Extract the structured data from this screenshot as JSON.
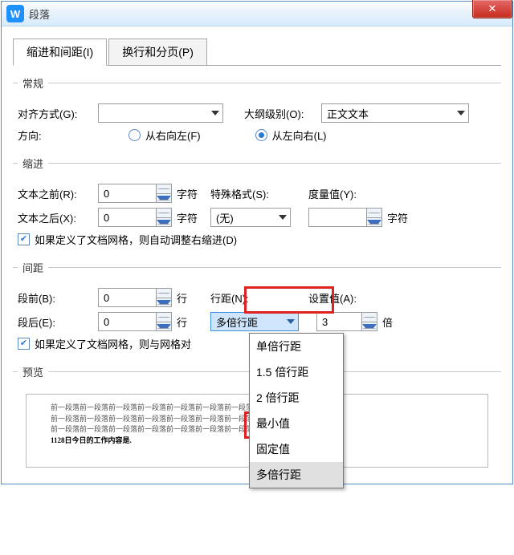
{
  "window": {
    "title": "段落",
    "icon_letter": "W",
    "close_glyph": "✕"
  },
  "tabs": {
    "indent": "缩进和间距(I)",
    "page": "换行和分页(P)"
  },
  "general": {
    "legend": "常规",
    "align_label": "对齐方式(G):",
    "outline_label": "大纲级别(O):",
    "outline_value": "正文文本",
    "direction_label": "方向:",
    "rtl": "从右向左(F)",
    "ltr": "从左向右(L)"
  },
  "indent": {
    "legend": "缩进",
    "before_label": "文本之前(R):",
    "before_value": "0",
    "after_label": "文本之后(X):",
    "after_value": "0",
    "unit": "字符",
    "special_label": "特殊格式(S):",
    "special_value": "(无)",
    "measure_label": "度量值(Y):",
    "check_text": "如果定义了文档网格，则自动调整右缩进(D)"
  },
  "spacing": {
    "legend": "间距",
    "before_label": "段前(B):",
    "before_value": "0",
    "after_label": "段后(E):",
    "after_value": "0",
    "line_unit": "行",
    "linespacing_label": "行距(N):",
    "linespacing_value": "多倍行距",
    "setvalue_label": "设置值(A):",
    "setvalue_value": "3",
    "setvalue_unit": "倍",
    "check_text": "如果定义了文档网格，则与网格对",
    "dropdown_options": [
      "单倍行距",
      "1.5 倍行距",
      "2 倍行距",
      "最小值",
      "固定值",
      "多倍行距"
    ]
  },
  "preview": {
    "legend": "预览",
    "line": "前一段落前一段落前一段落前一段落前一段落前一段落前一段落前一段落前一段落前一段落",
    "sample": "1128日今日的工作内容是."
  }
}
